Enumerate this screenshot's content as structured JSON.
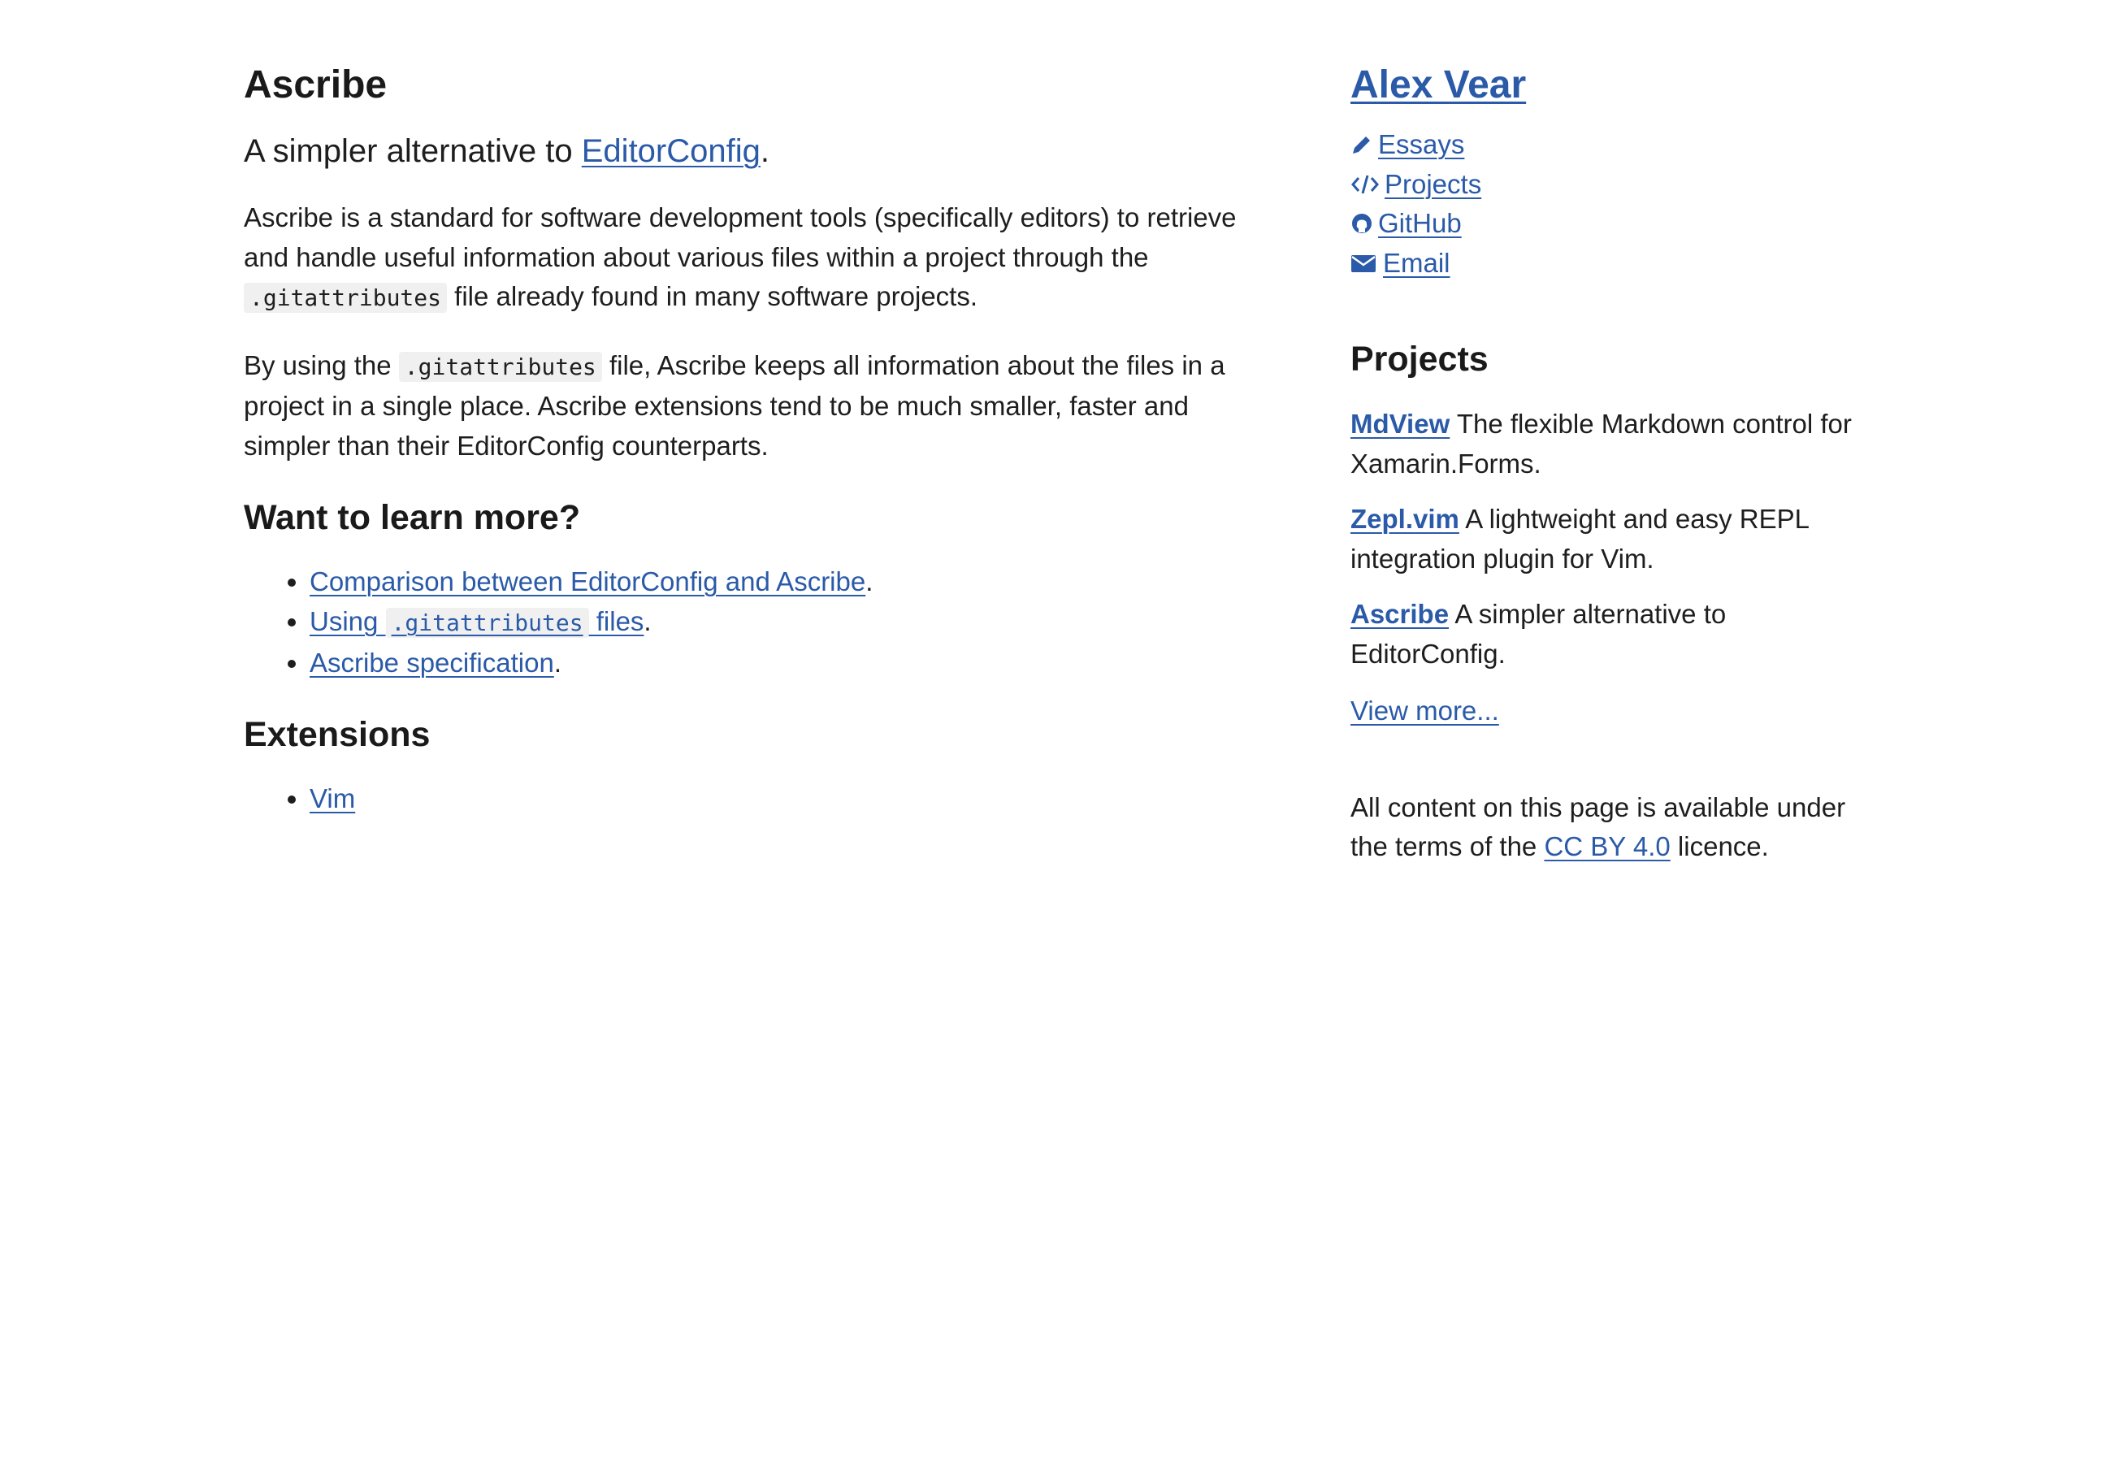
{
  "main": {
    "title": "Ascribe",
    "subtitle_prefix": "A simpler alternative to ",
    "subtitle_link": "EditorConfig",
    "subtitle_suffix": ".",
    "para1_a": "Ascribe is a standard for software development tools (specifically editors) to retrieve and handle useful information about various files within a project through the ",
    "para1_code": ".gitattributes",
    "para1_b": " file already found in many software projects.",
    "para2_a": "By using the ",
    "para2_code": ".gitattributes",
    "para2_b": " file, Ascribe keeps all information about the files in a project in a single place.  Ascribe extensions tend to be much smaller, faster and simpler than their EditorConfig counterparts.",
    "learn_heading": "Want to learn more?",
    "learn_items": [
      {
        "text": "Comparison between EditorConfig and Ascribe",
        "suffix": "."
      },
      {
        "text_a": "Using ",
        "code": ".gitattributes",
        "text_b": " files",
        "suffix": "."
      },
      {
        "text": "Ascribe specification",
        "suffix": "."
      }
    ],
    "extensions_heading": "Extensions",
    "extensions": [
      "Vim"
    ]
  },
  "sidebar": {
    "author": "Alex Vear",
    "nav": [
      {
        "label": "Essays",
        "icon": "pencil-icon"
      },
      {
        "label": "Projects",
        "icon": "code-icon"
      },
      {
        "label": "GitHub",
        "icon": "github-icon"
      },
      {
        "label": "Email",
        "icon": "envelope-icon"
      }
    ],
    "projects_heading": "Projects",
    "projects": [
      {
        "name": "MdView",
        "desc": " The flexible Markdown control for Xamarin.Forms."
      },
      {
        "name": "Zepl.vim",
        "desc": " A lightweight and easy REPL integration plugin for Vim."
      },
      {
        "name": "Ascribe",
        "desc": " A simpler alternative to EditorConfig."
      }
    ],
    "view_more": "View more...",
    "licence_a": "All content on this page is available under the terms of the ",
    "licence_link": "CC BY 4.0",
    "licence_b": " licence."
  },
  "colors": {
    "link": "#2a5aa8",
    "text": "#1e1e1e",
    "code_bg": "#f0f0f0"
  }
}
